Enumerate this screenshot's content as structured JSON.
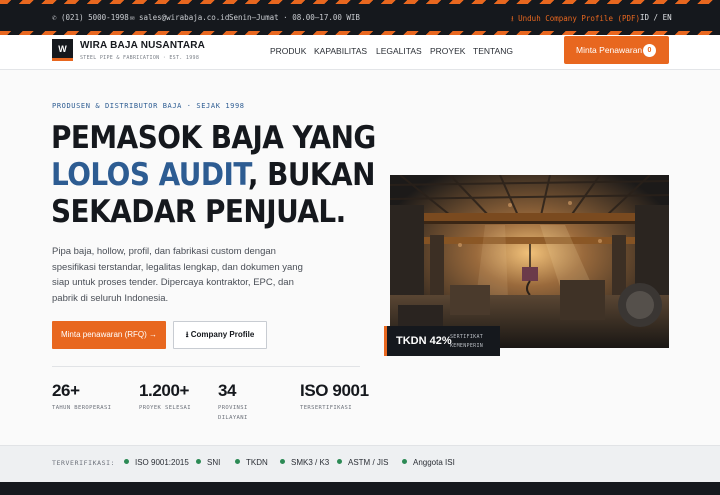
{
  "topbar": {
    "phone": "✆ (021) 5000-1998",
    "email": "✉ sales@wirabaja.co.id",
    "hours": "Senin–Jumat · 08.00–17.00 WIB",
    "download": "⭳ Unduh Company Profile (PDF)",
    "lang": "ID / EN"
  },
  "header": {
    "logo_letter": "W",
    "brand": "WIRA BAJA NUSANTARA",
    "tagline": "STEEL PIPE & FABRICATION · EST. 1998",
    "nav": [
      "PRODUK",
      "KAPABILITAS",
      "LEGALITAS",
      "PROYEK",
      "TENTANG"
    ],
    "cta_label": "Minta Penawaran",
    "cta_count": "0"
  },
  "hero": {
    "eyebrow": "PRODUSEN & DISTRIBUTOR BAJA · SEJAK 1998",
    "headline_line1": "PEMASOK BAJA YANG",
    "headline_accent": "LOLOS AUDIT",
    "headline_line2_rest": ", BUKAN",
    "headline_line3": "SEKADAR PENJUAL.",
    "lead": "Pipa baja, hollow, profil, dan fabrikasi custom dengan spesifikasi terstandar, legalitas lengkap, dan dokumen yang siap untuk proses tender. Dipercaya kontraktor, EPC, dan pabrik di seluruh Indonesia.",
    "primary_button": "Minta penawaran (RFQ) →",
    "secondary_button": "⭳ Company Profile"
  },
  "stats": [
    {
      "value": "26+",
      "label_line1": "TAHUN BEROPERASI",
      "label_line2": ""
    },
    {
      "value": "1.200+",
      "label_line1": "PROYEK SELESAI",
      "label_line2": ""
    },
    {
      "value": "34",
      "label_line1": "PROVINSI",
      "label_line2": "DILAYANI"
    },
    {
      "value": "ISO 9001",
      "label_line1": "TERSERTIFIKASI",
      "label_line2": ""
    }
  ],
  "badge": {
    "value": "TKDN 42%",
    "label_line1": "SERTIFIKAT",
    "label_line2": "KEMENPERIN"
  },
  "verification": {
    "label": "TERVERIFIKASI:",
    "items": [
      "ISO 9001:2015",
      "SNI",
      "TKDN",
      "SMK3 / K3",
      "ASTM / JIS",
      "Anggota ISI"
    ]
  },
  "colors": {
    "accent": "#e8671f",
    "dark": "#15181d",
    "blue": "#2d5c92",
    "verified": "#2c8a55"
  }
}
